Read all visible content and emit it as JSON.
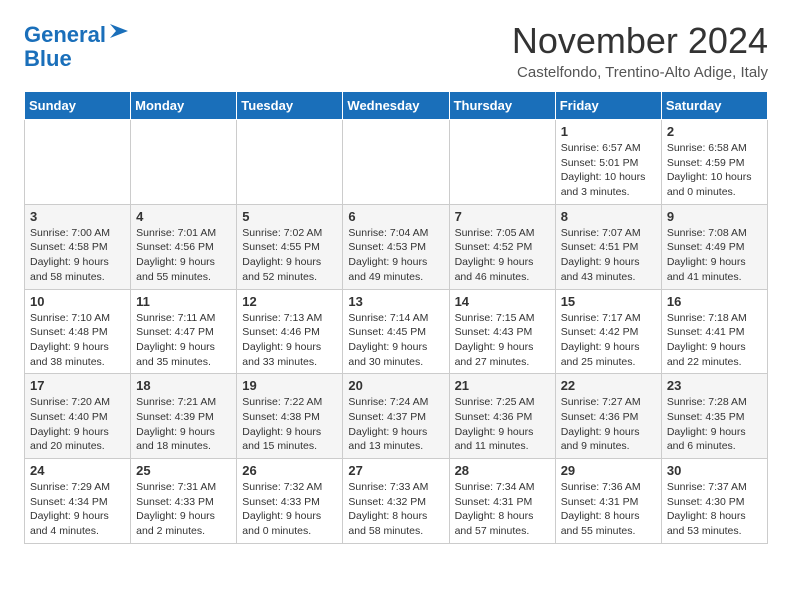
{
  "header": {
    "logo_line1": "General",
    "logo_line2": "Blue",
    "title": "November 2024",
    "location": "Castelfondo, Trentino-Alto Adige, Italy"
  },
  "days_of_week": [
    "Sunday",
    "Monday",
    "Tuesday",
    "Wednesday",
    "Thursday",
    "Friday",
    "Saturday"
  ],
  "weeks": [
    [
      {
        "day": "",
        "info": ""
      },
      {
        "day": "",
        "info": ""
      },
      {
        "day": "",
        "info": ""
      },
      {
        "day": "",
        "info": ""
      },
      {
        "day": "",
        "info": ""
      },
      {
        "day": "1",
        "info": "Sunrise: 6:57 AM\nSunset: 5:01 PM\nDaylight: 10 hours and 3 minutes."
      },
      {
        "day": "2",
        "info": "Sunrise: 6:58 AM\nSunset: 4:59 PM\nDaylight: 10 hours and 0 minutes."
      }
    ],
    [
      {
        "day": "3",
        "info": "Sunrise: 7:00 AM\nSunset: 4:58 PM\nDaylight: 9 hours and 58 minutes."
      },
      {
        "day": "4",
        "info": "Sunrise: 7:01 AM\nSunset: 4:56 PM\nDaylight: 9 hours and 55 minutes."
      },
      {
        "day": "5",
        "info": "Sunrise: 7:02 AM\nSunset: 4:55 PM\nDaylight: 9 hours and 52 minutes."
      },
      {
        "day": "6",
        "info": "Sunrise: 7:04 AM\nSunset: 4:53 PM\nDaylight: 9 hours and 49 minutes."
      },
      {
        "day": "7",
        "info": "Sunrise: 7:05 AM\nSunset: 4:52 PM\nDaylight: 9 hours and 46 minutes."
      },
      {
        "day": "8",
        "info": "Sunrise: 7:07 AM\nSunset: 4:51 PM\nDaylight: 9 hours and 43 minutes."
      },
      {
        "day": "9",
        "info": "Sunrise: 7:08 AM\nSunset: 4:49 PM\nDaylight: 9 hours and 41 minutes."
      }
    ],
    [
      {
        "day": "10",
        "info": "Sunrise: 7:10 AM\nSunset: 4:48 PM\nDaylight: 9 hours and 38 minutes."
      },
      {
        "day": "11",
        "info": "Sunrise: 7:11 AM\nSunset: 4:47 PM\nDaylight: 9 hours and 35 minutes."
      },
      {
        "day": "12",
        "info": "Sunrise: 7:13 AM\nSunset: 4:46 PM\nDaylight: 9 hours and 33 minutes."
      },
      {
        "day": "13",
        "info": "Sunrise: 7:14 AM\nSunset: 4:45 PM\nDaylight: 9 hours and 30 minutes."
      },
      {
        "day": "14",
        "info": "Sunrise: 7:15 AM\nSunset: 4:43 PM\nDaylight: 9 hours and 27 minutes."
      },
      {
        "day": "15",
        "info": "Sunrise: 7:17 AM\nSunset: 4:42 PM\nDaylight: 9 hours and 25 minutes."
      },
      {
        "day": "16",
        "info": "Sunrise: 7:18 AM\nSunset: 4:41 PM\nDaylight: 9 hours and 22 minutes."
      }
    ],
    [
      {
        "day": "17",
        "info": "Sunrise: 7:20 AM\nSunset: 4:40 PM\nDaylight: 9 hours and 20 minutes."
      },
      {
        "day": "18",
        "info": "Sunrise: 7:21 AM\nSunset: 4:39 PM\nDaylight: 9 hours and 18 minutes."
      },
      {
        "day": "19",
        "info": "Sunrise: 7:22 AM\nSunset: 4:38 PM\nDaylight: 9 hours and 15 minutes."
      },
      {
        "day": "20",
        "info": "Sunrise: 7:24 AM\nSunset: 4:37 PM\nDaylight: 9 hours and 13 minutes."
      },
      {
        "day": "21",
        "info": "Sunrise: 7:25 AM\nSunset: 4:36 PM\nDaylight: 9 hours and 11 minutes."
      },
      {
        "day": "22",
        "info": "Sunrise: 7:27 AM\nSunset: 4:36 PM\nDaylight: 9 hours and 9 minutes."
      },
      {
        "day": "23",
        "info": "Sunrise: 7:28 AM\nSunset: 4:35 PM\nDaylight: 9 hours and 6 minutes."
      }
    ],
    [
      {
        "day": "24",
        "info": "Sunrise: 7:29 AM\nSunset: 4:34 PM\nDaylight: 9 hours and 4 minutes."
      },
      {
        "day": "25",
        "info": "Sunrise: 7:31 AM\nSunset: 4:33 PM\nDaylight: 9 hours and 2 minutes."
      },
      {
        "day": "26",
        "info": "Sunrise: 7:32 AM\nSunset: 4:33 PM\nDaylight: 9 hours and 0 minutes."
      },
      {
        "day": "27",
        "info": "Sunrise: 7:33 AM\nSunset: 4:32 PM\nDaylight: 8 hours and 58 minutes."
      },
      {
        "day": "28",
        "info": "Sunrise: 7:34 AM\nSunset: 4:31 PM\nDaylight: 8 hours and 57 minutes."
      },
      {
        "day": "29",
        "info": "Sunrise: 7:36 AM\nSunset: 4:31 PM\nDaylight: 8 hours and 55 minutes."
      },
      {
        "day": "30",
        "info": "Sunrise: 7:37 AM\nSunset: 4:30 PM\nDaylight: 8 hours and 53 minutes."
      }
    ]
  ]
}
